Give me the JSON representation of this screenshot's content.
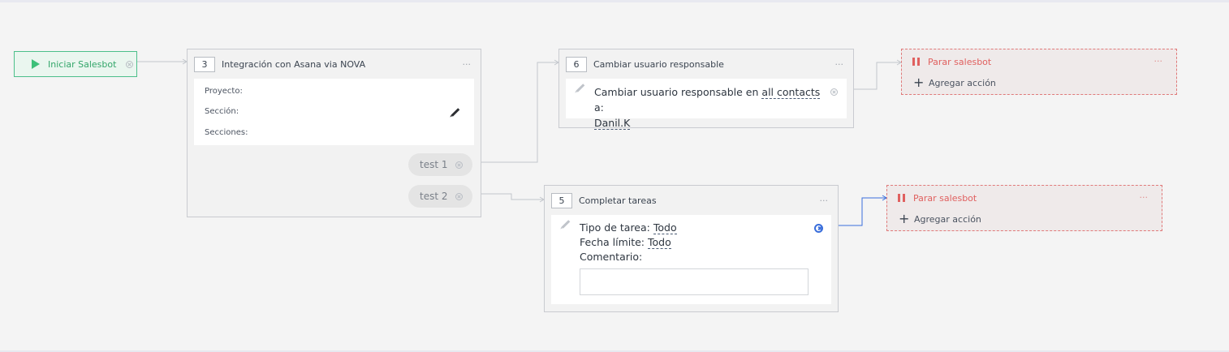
{
  "start": {
    "label": "Iniciar Salesbot"
  },
  "block3": {
    "number": "3",
    "title": "Integración con Asana via NOVA",
    "menu": "···",
    "fields": [
      "Proyecto:",
      "Sección:",
      "Secciones:"
    ],
    "branches": [
      "test 1",
      "test 2"
    ]
  },
  "block6": {
    "number": "6",
    "title": "Cambiar usuario responsable",
    "menu": "···",
    "text_prefix": "Cambiar usuario responsable en ",
    "text_link": "all contacts",
    "text_suffix": " a:",
    "user": "Danil.K"
  },
  "block5": {
    "number": "5",
    "title": "Completar tareas",
    "menu": "···",
    "task_type_label": "Tipo de tarea: ",
    "task_type_value": "Todo",
    "deadline_label": "Fecha límite: ",
    "deadline_value": "Todo",
    "comment_label": "Comentario:",
    "comment_value": ""
  },
  "stop_top": {
    "label": "Parar salesbot",
    "menu": "···",
    "add_label": "Agregar acción",
    "plus": "+"
  },
  "stop_bottom": {
    "label": "Parar salesbot",
    "menu": "···",
    "add_label": "Agregar acción",
    "plus": "+"
  },
  "colors": {
    "start_green": "#3ec07a",
    "stop_red": "#e0605f",
    "connector_gray": "#b8bdc4",
    "active_connector_blue": "#3a6edb"
  }
}
